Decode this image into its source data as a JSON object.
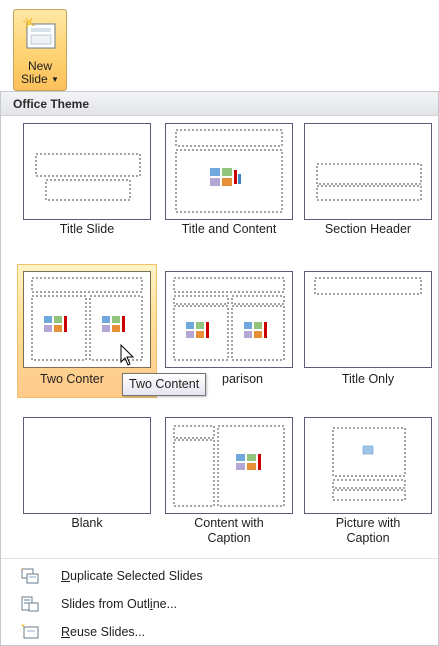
{
  "ribbon": {
    "new_slide_line1": "New",
    "new_slide_line2": "Slide",
    "caret_icon": "dropdown-caret-icon"
  },
  "gallery": {
    "header": "Office Theme",
    "layouts": [
      {
        "label": "Title Slide"
      },
      {
        "label": "Title and Content"
      },
      {
        "label": "Section Header"
      },
      {
        "label_visible": "Two Conter",
        "label": "Two Content"
      },
      {
        "label_visible": "parison",
        "label": "Comparison"
      },
      {
        "label": "Title Only"
      },
      {
        "label": "Blank"
      },
      {
        "label_line1": "Content with",
        "label_line2": "Caption"
      },
      {
        "label_line1": "Picture with",
        "label_line2": "Caption"
      }
    ],
    "hovered_index": 3
  },
  "tooltip": {
    "text": "Two Content"
  },
  "menu": {
    "items": [
      {
        "pre": "",
        "underlined": "D",
        "post": "uplicate Selected Slides",
        "icon": "duplicate-slides-icon"
      },
      {
        "pre": "Slides from Outl",
        "underlined": "i",
        "post": "ne...",
        "icon": "slides-from-outline-icon"
      },
      {
        "pre": "",
        "underlined": "R",
        "post": "euse Slides...",
        "icon": "reuse-slides-icon"
      }
    ]
  },
  "colors": {
    "hover_top": "#ffe199",
    "hover_bottom": "#ffc98a",
    "thumb_border": "#5b5b7a",
    "accent_orange": "#fbc05a"
  }
}
